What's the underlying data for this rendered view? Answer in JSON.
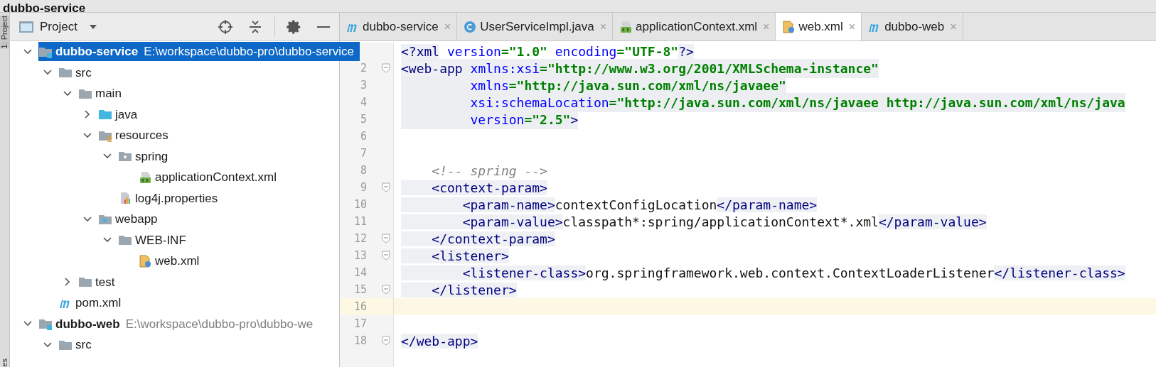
{
  "breadcrumb": {
    "label": "dubbo-service"
  },
  "side_tabs": [
    {
      "label": "1: Project",
      "kind": "top"
    },
    {
      "label": "es",
      "kind": "bottom"
    }
  ],
  "project_panel": {
    "title": "Project",
    "tree": [
      {
        "label": "dubbo-service",
        "path": "E:\\workspace\\dubbo-pro\\dubbo-service",
        "kind": "module",
        "selected": true,
        "expanded": true,
        "children": [
          {
            "label": "src",
            "kind": "folder",
            "selected": false,
            "expanded": true,
            "children": [
              {
                "label": "main",
                "kind": "folder",
                "selected": false,
                "expanded": true,
                "children": [
                  {
                    "label": "java",
                    "kind": "source",
                    "selected": false,
                    "expanded": false
                  },
                  {
                    "label": "resources",
                    "kind": "resources",
                    "selected": false,
                    "expanded": true,
                    "children": [
                      {
                        "label": "spring",
                        "kind": "package",
                        "selected": false,
                        "expanded": true,
                        "children": [
                          {
                            "label": "applicationContext.xml",
                            "kind": "spring",
                            "selected": false
                          }
                        ]
                      },
                      {
                        "label": "log4j.properties",
                        "kind": "properties",
                        "selected": false
                      }
                    ]
                  },
                  {
                    "label": "webapp",
                    "kind": "web",
                    "selected": false,
                    "expanded": true,
                    "children": [
                      {
                        "label": "WEB-INF",
                        "kind": "folder",
                        "selected": false,
                        "expanded": true,
                        "children": [
                          {
                            "label": "web.xml",
                            "kind": "descriptor",
                            "selected": false
                          }
                        ]
                      }
                    ]
                  }
                ]
              },
              {
                "label": "test",
                "kind": "folder",
                "selected": false,
                "expanded": false
              }
            ]
          },
          {
            "label": "pom.xml",
            "kind": "maven",
            "selected": false
          }
        ]
      },
      {
        "label": "dubbo-web",
        "path": "E:\\workspace\\dubbo-pro\\dubbo-we",
        "kind": "module",
        "selected": false,
        "expanded": true,
        "children": [
          {
            "label": "src",
            "kind": "folder",
            "selected": false,
            "expanded": true
          }
        ]
      }
    ]
  },
  "tabs": [
    {
      "label": "dubbo-service",
      "kind": "maven",
      "close": "×",
      "selected": false
    },
    {
      "label": "UserServiceImpl.java",
      "kind": "class",
      "close": "×",
      "selected": false
    },
    {
      "label": "applicationContext.xml",
      "kind": "spring",
      "close": "×",
      "selected": false
    },
    {
      "label": "web.xml",
      "kind": "descriptor",
      "close": "×",
      "selected": true
    },
    {
      "label": "dubbo-web",
      "kind": "maven",
      "close": "×",
      "selected": false
    }
  ],
  "editor": {
    "lines": [
      {
        "tokens": [
          {
            "kind": "tag",
            "text": "<?xml"
          },
          {
            "kind": "attr",
            "text": " version"
          },
          {
            "kind": "value",
            "text": "=\"1.0\""
          },
          {
            "kind": "attr",
            "text": " encoding"
          },
          {
            "kind": "value",
            "text": "=\"UTF-8\""
          },
          {
            "kind": "tag",
            "text": "?>"
          }
        ]
      },
      {
        "number": "2",
        "fold": true,
        "highlighted": true,
        "tokens": [
          {
            "kind": "tag",
            "text": "<web-app"
          },
          {
            "kind": "attr",
            "text": " xmlns:xsi"
          },
          {
            "kind": "value",
            "text": "=\"http://www.w3.org/2001/XMLSchema-instance\""
          }
        ]
      },
      {
        "number": "3",
        "highlighted": true,
        "tokens": [
          {
            "kind": "attr",
            "text": "         xmlns"
          },
          {
            "kind": "value",
            "text": "=\"http://java.sun.com/xml/ns/javaee\""
          }
        ]
      },
      {
        "number": "4",
        "highlighted": true,
        "tokens": [
          {
            "kind": "attr",
            "text": "         xsi:schemaLocation"
          },
          {
            "kind": "value",
            "text": "=\"http://java.sun.com/xml/ns/javaee http://java.sun.com/xml/ns/java"
          }
        ]
      },
      {
        "number": "5",
        "highlighted": true,
        "tokens": [
          {
            "kind": "attr",
            "text": "         version"
          },
          {
            "kind": "value",
            "text": "=\"2.5\""
          },
          {
            "kind": "tag",
            "text": ">"
          }
        ]
      },
      {
        "number": "6"
      },
      {
        "number": "7"
      },
      {
        "number": "8",
        "tokens": [
          {
            "kind": "comment",
            "text": "    <!-- spring -->"
          }
        ]
      },
      {
        "number": "9",
        "fold": true,
        "tokens": [
          {
            "kind": "tag",
            "text": "    <context-param>"
          }
        ]
      },
      {
        "number": "10",
        "tokens": [
          {
            "kind": "tag",
            "text": "        <param-name>"
          },
          {
            "kind": "text",
            "text": "contextConfigLocation"
          },
          {
            "kind": "tag",
            "text": "</param-name>"
          }
        ]
      },
      {
        "number": "11",
        "tokens": [
          {
            "kind": "tag",
            "text": "        <param-value>"
          },
          {
            "kind": "text",
            "text": "classpath*:spring/applicationContext*.xml"
          },
          {
            "kind": "tag",
            "text": "</param-value>"
          }
        ]
      },
      {
        "number": "12",
        "fold": true,
        "tokens": [
          {
            "kind": "tag",
            "text": "    </context-param>"
          }
        ]
      },
      {
        "number": "13",
        "fold": true,
        "tokens": [
          {
            "kind": "tag",
            "text": "    <listener>"
          }
        ]
      },
      {
        "number": "14",
        "tokens": [
          {
            "kind": "tag",
            "text": "        <listener-class>"
          },
          {
            "kind": "text",
            "text": "org.springframework.web.context.ContextLoaderListener"
          },
          {
            "kind": "tag",
            "text": "</listener-class>"
          }
        ]
      },
      {
        "number": "15",
        "fold": true,
        "tokens": [
          {
            "kind": "tag",
            "text": "    </listener>"
          }
        ]
      },
      {
        "number": "16",
        "current": true
      },
      {
        "number": "17"
      },
      {
        "number": "18",
        "fold": true,
        "tokens": [
          {
            "kind": "tag",
            "text": "</web-app>"
          }
        ]
      }
    ]
  }
}
